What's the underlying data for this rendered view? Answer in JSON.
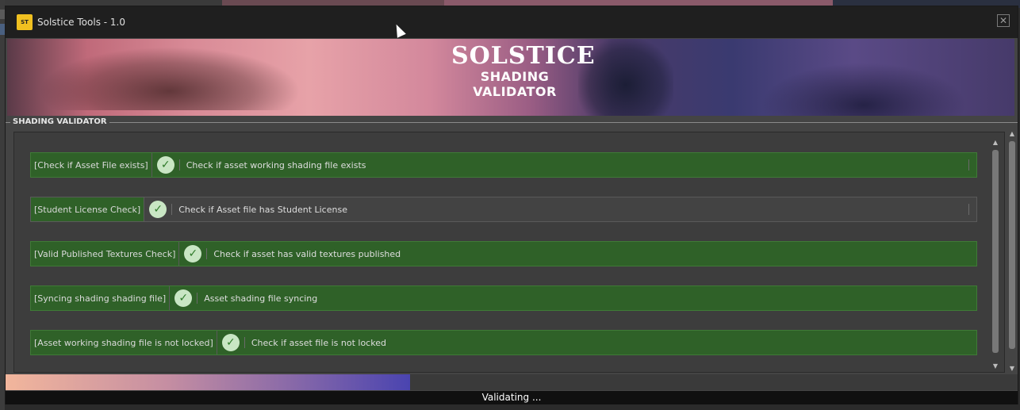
{
  "window": {
    "title": "Solstice Tools - 1.0",
    "app_icon_text": "ST",
    "close_glyph": "✕"
  },
  "banner": {
    "brand": "SOLSTICE",
    "line1": "SHADING",
    "line2": "VALIDATOR"
  },
  "group": {
    "label": "SHADING VALIDATOR"
  },
  "checks": [
    {
      "label": "[Check if Asset File exists]",
      "description": "Check if asset working shading file exists",
      "status": "passed",
      "tail_divider": true
    },
    {
      "label": "[Student License Check]",
      "description": "Check if Asset file has Student License",
      "status": "passed",
      "tail_divider": true
    },
    {
      "label": "[Valid Published Textures Check]",
      "description": "Check if asset has valid textures published",
      "status": "passed",
      "tail_divider": false
    },
    {
      "label": "[Syncing shading shading file]",
      "description": "Asset shading file syncing",
      "status": "passed",
      "tail_divider": false
    },
    {
      "label": "[Asset working shading file is not locked]",
      "description": "Check if asset file is not locked",
      "status": "passed",
      "tail_divider": false
    }
  ],
  "progress": {
    "percent": 40
  },
  "status_text": "Validating ...",
  "colors": {
    "pass_green": "#2f6128",
    "ok_icon_bg": "#c9e6c4",
    "window_bg": "#444444",
    "titlebar_bg": "#1f1f1f"
  },
  "icons": {
    "ok": "check-circle-icon",
    "close": "close-icon",
    "scroll_up": "arrow-up-icon",
    "scroll_down": "arrow-down-icon"
  }
}
